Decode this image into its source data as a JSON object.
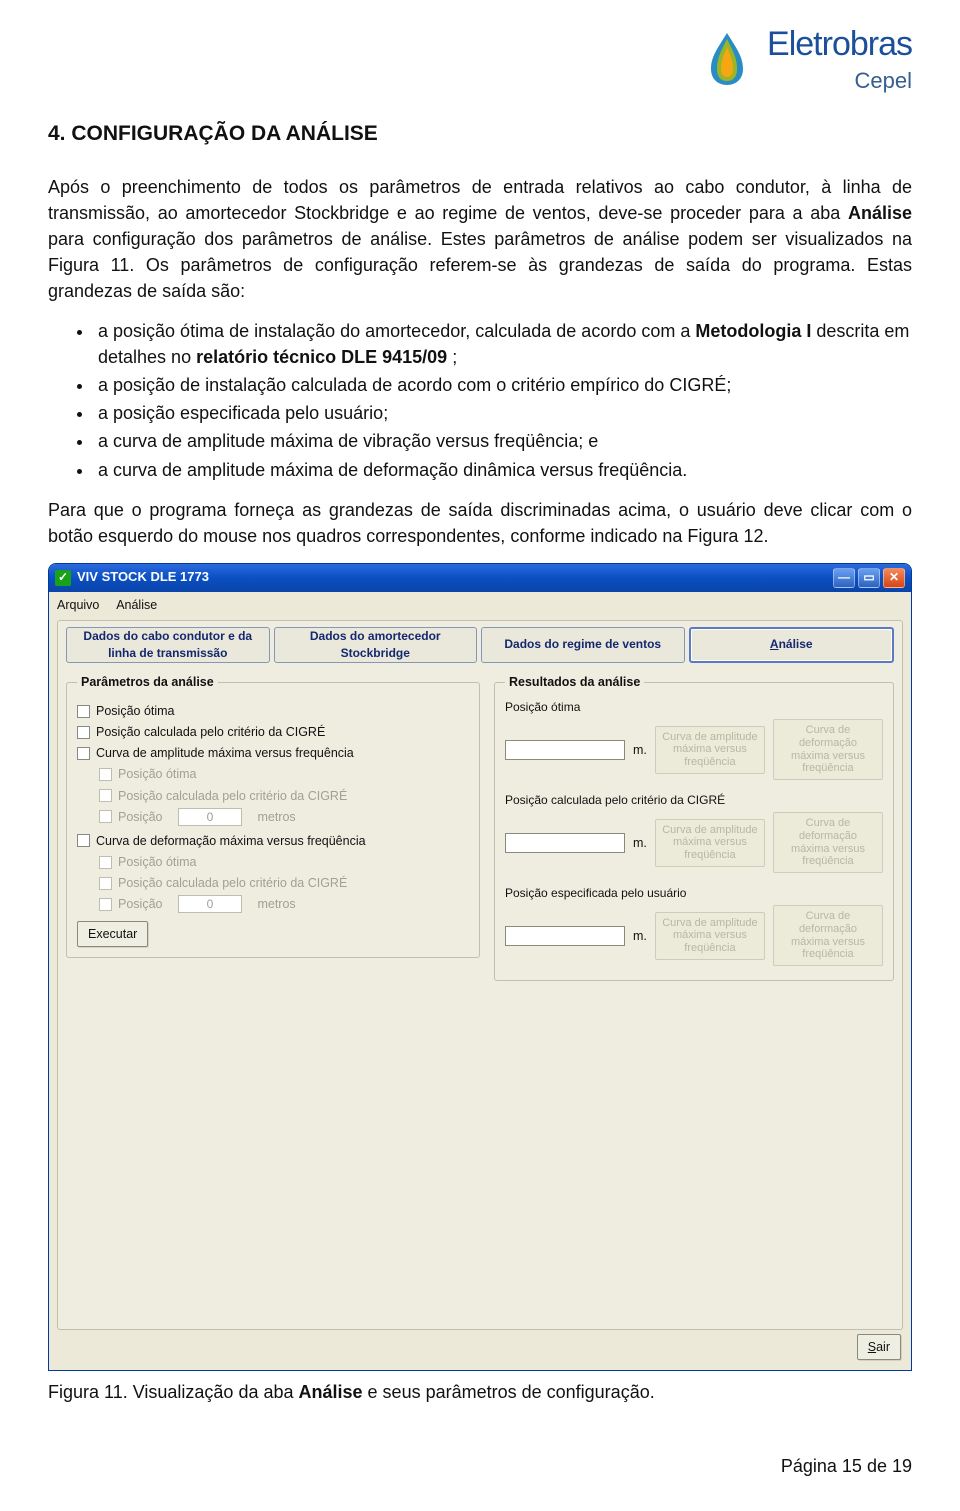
{
  "logo": {
    "brand": "Eletrobras",
    "sub": "Cepel"
  },
  "heading": "4. CONFIGURAÇÃO DA ANÁLISE",
  "para1a": "Após o preenchimento de todos os parâmetros de entrada relativos ao cabo condutor, à linha de transmissão, ao amortecedor Stockbridge e ao regime de ventos, deve-se proceder para a aba ",
  "para1b_bold": "Análise",
  "para1c": " para configuração dos parâmetros de análise. Estes parâmetros de análise podem ser visualizados na Figura 11. Os parâmetros de configuração referem-se às grandezas de saída do programa. Estas grandezas de saída são:",
  "bullets": {
    "b1a": "a posição ótima de instalação do amortecedor, calculada de acordo com a ",
    "b1b_bold": "Metodologia I",
    "b1c": " descrita em detalhes no ",
    "b1d_bold": "relatório técnico DLE 9415/09",
    "b1e": ";",
    "b2": "a posição de instalação calculada de acordo com o critério empírico do CIGRÉ;",
    "b3": "a posição especificada pelo usuário;",
    "b4": "a curva de amplitude máxima de vibração versus freqüência; e",
    "b5": "a curva de amplitude máxima de deformação dinâmica versus freqüência."
  },
  "para2": "Para que o programa forneça as grandezas de saída discriminadas acima, o usuário deve clicar com o botão esquerdo do mouse nos quadros correspondentes, conforme indicado na Figura 12.",
  "win": {
    "title": "VIV STOCK DLE 1773",
    "menu": {
      "m1": "Arquivo",
      "m2": "Análise"
    },
    "tabs": {
      "t1": "Dados do cabo condutor e da linha de transmissão",
      "t2": "Dados do amortecedor Stockbridge",
      "t3": "Dados do regime de ventos",
      "t4_pre": "A",
      "t4_rest": "nálise"
    },
    "params": {
      "legend": "Parâmetros da análise",
      "chk1": "Posição ótima",
      "chk2": "Posição calculada pelo critério da CIGRÉ",
      "chk3": "Curva de amplitude máxima versus frequência",
      "sub_chk1": "Posição ótima",
      "sub_chk2": "Posição calculada pelo critério da CIGRÉ",
      "sub_chk3": "Posição",
      "zero": "0",
      "unit_m": "metros",
      "chk4": "Curva de deformação máxima versus freqüência",
      "execute": "Executar"
    },
    "results": {
      "legend": "Resultados da análise",
      "r1": "Posição ótima",
      "r2": "Posição calculada pelo critério da CIGRÉ",
      "r3": "Posição especificada pelo usuário",
      "unit": "m.",
      "btn_amp": "Curva de amplitude máxima versus freqüência",
      "btn_def": "Curva de deformação máxima versus freqüência"
    },
    "exit_pre": "S",
    "exit_rest": "air"
  },
  "caption_a": "Figura 11. Visualização da aba ",
  "caption_bold": "Análise",
  "caption_b": " e seus parâmetros de configuração.",
  "footer": "Página 15 de 19"
}
